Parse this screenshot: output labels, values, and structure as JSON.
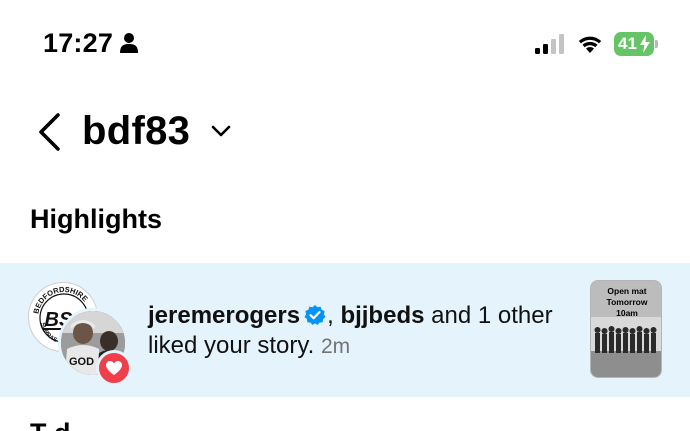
{
  "status_bar": {
    "time": "17:27",
    "battery": "41"
  },
  "header": {
    "title": "bdf83"
  },
  "highlights": {
    "title": "Highlights"
  },
  "notification": {
    "user1": "jeremerogers",
    "separator": ",",
    "user2": "bjjbeds",
    "rest": "and 1 other liked your story.",
    "time": "2m",
    "avatar_back_text": "BSJ",
    "avatar_back_ring_top": "BEDFORDSHIRE",
    "avatar_back_ring_side": "SURRAS",
    "avatar_front_text": "GOD",
    "story_text_lines": [
      "Open mat",
      "Tomorrow",
      "10am"
    ]
  },
  "next_section": {
    "title_partial": "T d"
  },
  "colors": {
    "highlight_bg": "#e5f3fd",
    "verified": "#0095f6",
    "heart_badge": "#ef3f4b",
    "battery": "#65c466"
  }
}
